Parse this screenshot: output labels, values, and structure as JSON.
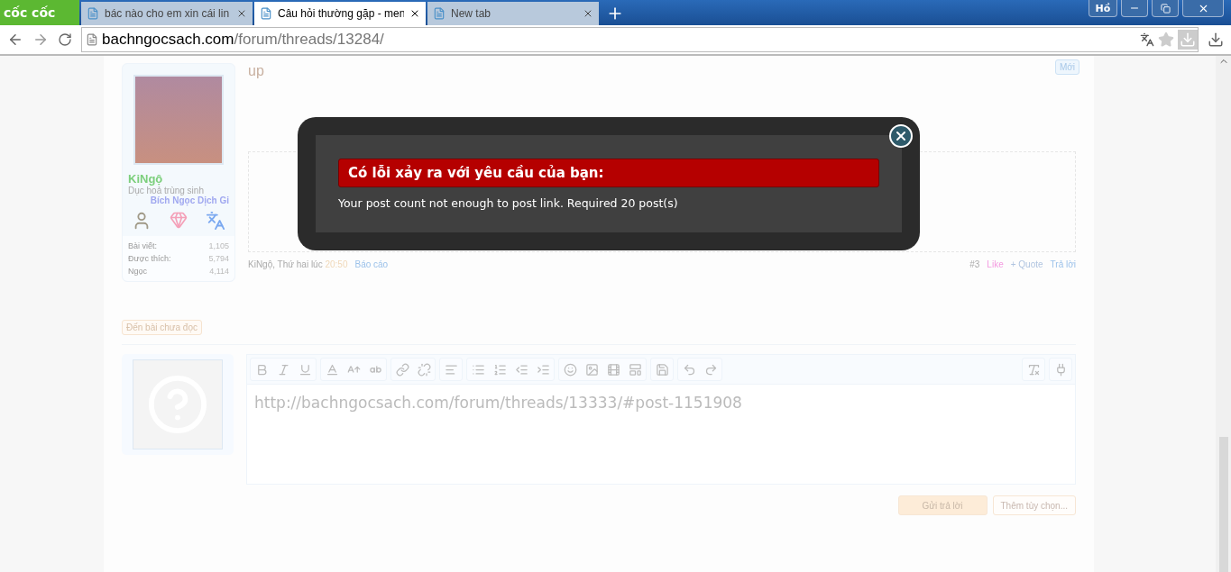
{
  "browser": {
    "logo": "cốc cốc",
    "tabs": [
      {
        "title": "bác nào cho em xin cái lin",
        "selected": false
      },
      {
        "title": "Câu hỏi thường gặp - men",
        "selected": true
      },
      {
        "title": "New tab",
        "selected": false
      }
    ],
    "profile": "Hồ",
    "url": {
      "host": "bachngocsach.com",
      "path": "/forum/threads/13284/"
    }
  },
  "post": {
    "username": "KiNgộ",
    "user_title": "Dục hoả trùng sinh",
    "rank": "Bích Ngọc Dịch Gi",
    "stats": [
      {
        "label": "Bài viết:",
        "value": "1,105"
      },
      {
        "label": "Được thích:",
        "value": "5,794"
      },
      {
        "label": "Ngọc",
        "value": "4,114"
      }
    ],
    "message": "up",
    "badge": "Mới",
    "meta": {
      "author": "KiNgộ, Thứ hai lúc",
      "time": "20:50",
      "report": "Báo cáo"
    },
    "number": "#3",
    "actions": [
      {
        "kind": "like",
        "label": "Like"
      },
      {
        "kind": "quote",
        "label": "+ Quote"
      },
      {
        "kind": "reply",
        "label": "Trả lời"
      }
    ]
  },
  "unread_link": "Đến bài chưa đọc",
  "editor": {
    "toolbar": [
      [
        {
          "kind": "bold"
        },
        {
          "kind": "italic"
        },
        {
          "kind": "underline"
        }
      ],
      [
        {
          "kind": "color"
        },
        {
          "kind": "size"
        },
        {
          "kind": "font"
        }
      ],
      [
        {
          "kind": "link"
        },
        {
          "kind": "unlink"
        }
      ],
      [
        {
          "kind": "align"
        }
      ],
      [
        {
          "kind": "bullets"
        },
        {
          "kind": "numbers"
        },
        {
          "kind": "outdent"
        },
        {
          "kind": "indent"
        }
      ],
      [
        {
          "kind": "smiley"
        },
        {
          "kind": "image"
        },
        {
          "kind": "media"
        },
        {
          "kind": "template"
        }
      ],
      [
        {
          "kind": "save"
        }
      ],
      [
        {
          "kind": "undo"
        },
        {
          "kind": "redo"
        }
      ]
    ],
    "toolbar_right": [
      {
        "kind": "clear"
      },
      {
        "kind": "plugin"
      }
    ],
    "value": "http://bachngocsach.com/forum/threads/13333/#post-1151908",
    "buttons": [
      {
        "kind": "primary",
        "label": "Gửi trả lời"
      },
      {
        "kind": "secondary",
        "label": "Thêm tùy chọn..."
      }
    ]
  },
  "modal": {
    "title": "Có lỗi xảy ra với yêu cầu của bạn:",
    "message": "Your post count not enough to post link. Required 20 post(s)"
  }
}
